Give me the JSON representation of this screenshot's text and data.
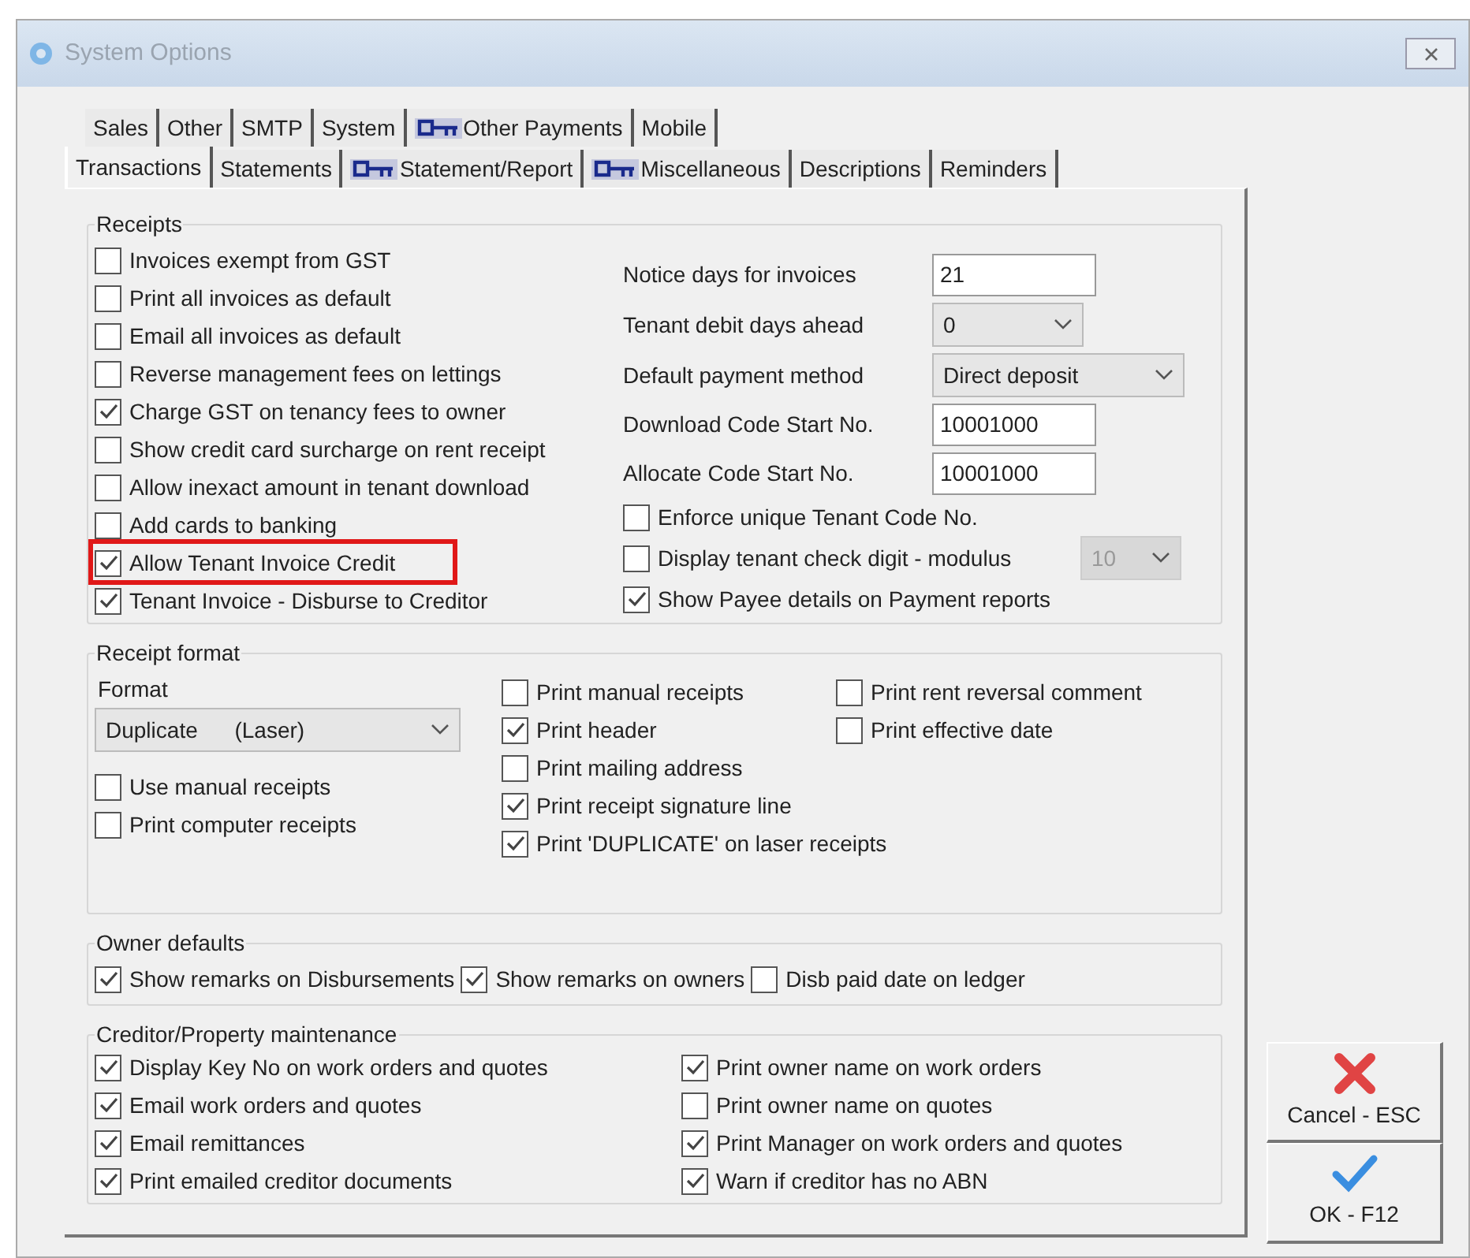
{
  "window": {
    "title": "System Options"
  },
  "tab_rows": [
    [
      {
        "label": "Sales",
        "locked": false,
        "selected": false
      },
      {
        "label": "Other",
        "locked": false,
        "selected": false
      },
      {
        "label": "SMTP",
        "locked": false,
        "selected": false
      },
      {
        "label": "System",
        "locked": false,
        "selected": false
      },
      {
        "label": "Other Payments",
        "locked": true,
        "selected": false
      },
      {
        "label": "Mobile",
        "locked": false,
        "selected": false
      }
    ],
    [
      {
        "label": "Transactions",
        "locked": false,
        "selected": true
      },
      {
        "label": "Statements",
        "locked": false,
        "selected": false
      },
      {
        "label": "Statement/Report",
        "locked": true,
        "selected": false
      },
      {
        "label": "Miscellaneous",
        "locked": true,
        "selected": false
      },
      {
        "label": "Descriptions",
        "locked": false,
        "selected": false
      },
      {
        "label": "Reminders",
        "locked": false,
        "selected": false
      }
    ]
  ],
  "receipts": {
    "title": "Receipts",
    "options": [
      {
        "label": "Invoices exempt from GST",
        "checked": false,
        "highlighted": false
      },
      {
        "label": "Print all invoices as default",
        "checked": false,
        "highlighted": false
      },
      {
        "label": "Email all invoices as default",
        "checked": false,
        "highlighted": false
      },
      {
        "label": "Reverse management fees on lettings",
        "checked": false,
        "highlighted": false
      },
      {
        "label": "Charge GST on tenancy fees to owner",
        "checked": true,
        "highlighted": false
      },
      {
        "label": "Show credit card surcharge on rent receipt",
        "checked": false,
        "highlighted": false
      },
      {
        "label": "Allow inexact amount in tenant download",
        "checked": false,
        "highlighted": false
      },
      {
        "label": "Add cards to banking",
        "checked": false,
        "highlighted": false
      },
      {
        "label": "Allow Tenant Invoice Credit",
        "checked": true,
        "highlighted": true
      },
      {
        "label": "Tenant Invoice - Disburse to Creditor",
        "checked": true,
        "highlighted": false
      }
    ],
    "settings": [
      {
        "kind": "text",
        "label": "Notice days for invoices",
        "value": "21"
      },
      {
        "kind": "select",
        "label": "Tenant debit days ahead",
        "value": "0"
      },
      {
        "kind": "select",
        "label": "Default payment method",
        "value": "Direct deposit"
      },
      {
        "kind": "text",
        "label": "Download Code Start No.",
        "value": "10001000"
      },
      {
        "kind": "text",
        "label": "Allocate Code Start No.",
        "value": "10001000"
      },
      {
        "kind": "checkbox",
        "label": "Enforce unique Tenant Code No.",
        "checked": false
      },
      {
        "kind": "checkbox",
        "label": "Display tenant check digit - modulus",
        "checked": false,
        "select_value": "10",
        "select_disabled": true
      },
      {
        "kind": "checkbox",
        "label": "Show Payee details on Payment reports",
        "checked": true
      }
    ]
  },
  "receipt_format": {
    "title": "Receipt format",
    "format_label": "Format",
    "format_value": "Duplicate      (Laser)",
    "left_options": [
      {
        "label": "Use manual receipts",
        "checked": false
      },
      {
        "label": "Print computer receipts",
        "checked": false
      }
    ],
    "middle_options": [
      {
        "label": "Print manual receipts",
        "checked": false
      },
      {
        "label": "Print header",
        "checked": true
      },
      {
        "label": "Print mailing address",
        "checked": false
      },
      {
        "label": "Print receipt signature line",
        "checked": true
      },
      {
        "label": "Print 'DUPLICATE' on laser receipts",
        "checked": true
      }
    ],
    "right_options": [
      {
        "label": "Print rent reversal comment",
        "checked": false
      },
      {
        "label": "Print effective date",
        "checked": false
      }
    ]
  },
  "owner_defaults": {
    "title": "Owner defaults",
    "options": [
      {
        "label": "Show remarks on Disbursements",
        "checked": true
      },
      {
        "label": "Show remarks on owners",
        "checked": true
      },
      {
        "label": "Disb paid date on ledger",
        "checked": false
      }
    ]
  },
  "creditor_maintenance": {
    "title": "Creditor/Property maintenance",
    "left_options": [
      {
        "label": "Display Key No on work orders and quotes",
        "checked": true
      },
      {
        "label": "Email work orders and quotes",
        "checked": true
      },
      {
        "label": "Email remittances",
        "checked": true
      },
      {
        "label": "Print emailed creditor documents",
        "checked": true
      }
    ],
    "right_options": [
      {
        "label": "Print owner name on work orders",
        "checked": true
      },
      {
        "label": "Print owner name on quotes",
        "checked": false
      },
      {
        "label": "Print Manager on work orders and quotes",
        "checked": true
      },
      {
        "label": "Warn if creditor has no ABN",
        "checked": true
      }
    ]
  },
  "buttons": [
    {
      "kind": "cancel",
      "label": "Cancel - ESC"
    },
    {
      "kind": "ok",
      "label": "OK - F12"
    }
  ]
}
